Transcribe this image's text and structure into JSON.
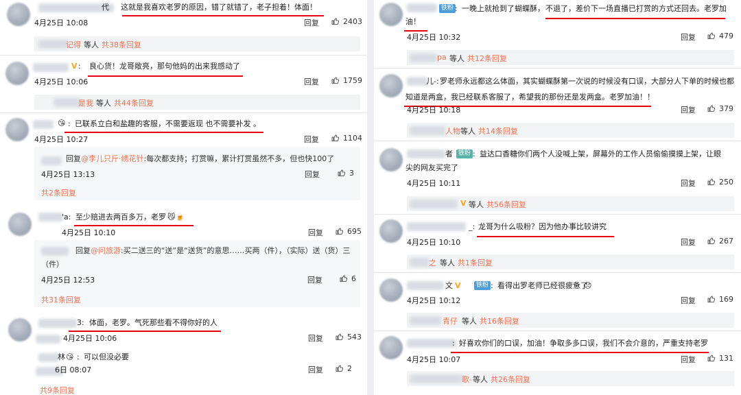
{
  "left": {
    "c1": {
      "text_hl": "这就是我喜欢老罗的原因，错了就错了，老子担着！体面！",
      "prefix": "代",
      "time": "4月25日 10:08",
      "reply": "回复",
      "likes": "2403"
    },
    "t1": {
      "name_tail": "记得",
      "wait": "等人",
      "count": "共38条回复"
    },
    "c2": {
      "text": "良心货！龙哥敞亮，那句他妈的出来我感动了",
      "time": "4月25日 10:06",
      "reply": "回复",
      "likes": "1759"
    },
    "t2": {
      "name_tail": "是我",
      "wait": "等人",
      "count": "共44条回复"
    },
    "c3": {
      "text": "已联系立白和盐趣的客服，不需要返现 也不需要补发 。",
      "emoji": "😘",
      "time": "4月25日 10:27",
      "reply": "回复",
      "likes": "1104"
    },
    "s1": {
      "reply_word": "回复",
      "at": "@李儿只斤·绣花针",
      "text": ":每次都支持；打赏嘛，累计打赏虽然不多，但也快100了",
      "time": "4月25日 13:13",
      "reply": "回复",
      "likes": "3"
    },
    "s1more": "共2条回复",
    "c4": {
      "prefix": "'a:",
      "text": "至少赔进去两百多万，老罗",
      "emoji": "😼🍺",
      "time": "4月25日 10:10",
      "reply": "回复",
      "likes": "695"
    },
    "s2": {
      "reply_word": "回复",
      "at": "@问旅游",
      "text": ":买二送三的“送”是“送货”的意思……买两（件），（实际）送（货）三（件）",
      "time": "4月25日 12:53",
      "reply": "回复",
      "likes": "6"
    },
    "s2more": "共31条回复",
    "c5": {
      "prefix": "3:",
      "text": "体面，老罗。气死那些看不得你好的人",
      "time": "4月25日 10:06",
      "reply": "回复",
      "likes": "543"
    },
    "c6": {
      "name_tail": "林",
      "emoji": "😘",
      "text": "可以但没必要",
      "time": "6日 08:07",
      "reply": "回复",
      "likes": "2"
    },
    "c6more": "共9条回复"
  },
  "right": {
    "c1": {
      "tag": "铁粉",
      "text_a": "一晚上就抢到了蝴蝶酥，",
      "text_b": "不退了，差价下一场直播已打赏的方式还回去。老罗加",
      "text_c": "油！",
      "time": "4月25日 10:32",
      "reply": "回复",
      "likes": "479"
    },
    "t1": {
      "name_tail": "pa",
      "wait": "等人",
      "count": "共12条回复"
    },
    "c2": {
      "prefix": "儿-:",
      "text_a": "罗老师永远都这么体面，其实蝴蝶酥第一次说的时候没有口误，大部分人下单的时候也都",
      "text_b": "知道是两盒，我已经联系客服了，希望我的那份还是发两盒。老罗加油！！",
      "time": "4月25日 10:18",
      "reply": "回复",
      "likes": "379"
    },
    "t2": {
      "name_tail": "人物",
      "wait": "等人",
      "count": "共14条回复"
    },
    "c3": {
      "prefix": "者",
      "tag": "铁粉",
      "text_a": "益达口香糖你们两个人没喊上架，屏幕外的工作人员偷偷摸摸上架，让眼",
      "text_b": "尖的网友买完了",
      "time": "4月25日 10:11",
      "reply": "回复",
      "likes": "250"
    },
    "t3": {
      "wait": "等人",
      "count": "共56条回复"
    },
    "c4": {
      "prefix": "_:",
      "text": "龙哥为什么吸粉？因为他办事比较讲究",
      "time": "4月25日 10:10",
      "reply": "回复",
      "likes": "267"
    },
    "t4": {
      "name_tail": "之",
      "wait": "等人",
      "count": "共1条回复"
    },
    "c5": {
      "prefix": "文",
      "tag": "铁粉",
      "text": "看得出罗老师已经很疲惫了",
      "emoji": "😞",
      "time": "4月25日 10:12",
      "reply": "回复",
      "likes": "169"
    },
    "t5": {
      "name_tail": "青仔",
      "wait": "等人",
      "count": "共16条回复"
    },
    "c6": {
      "text": "好喜欢你们的口误，加油！争取多多口误，我们不会介意的，严重支持老罗",
      "time": "4月25日 10:07",
      "reply": "回复",
      "likes": "131"
    },
    "t6": {
      "name_tail": "歌-",
      "wait": "等人",
      "count": "共26条回复"
    }
  }
}
